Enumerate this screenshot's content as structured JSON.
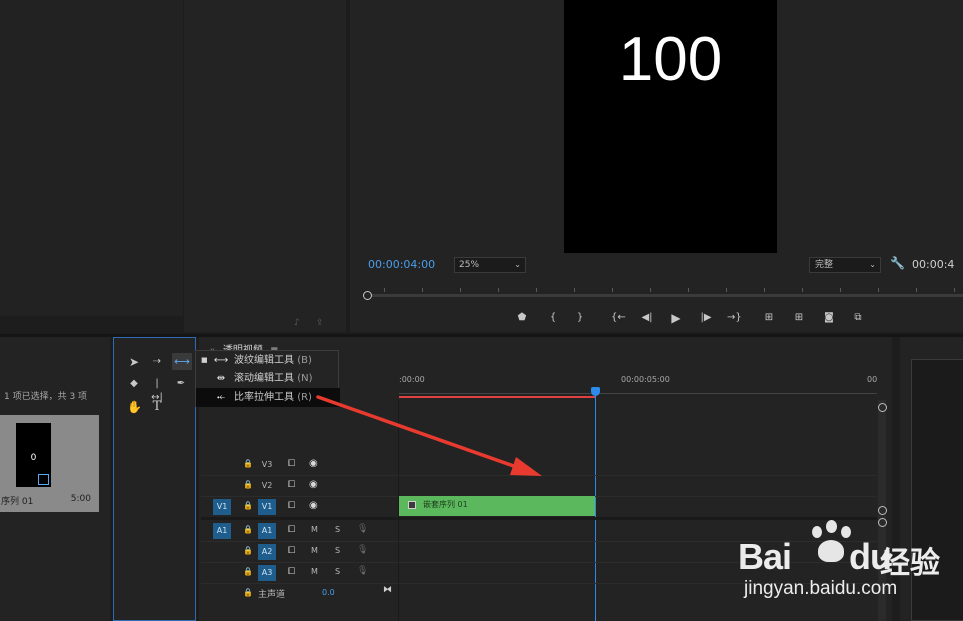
{
  "project_panel": {
    "selection_info": "1 项已选择，共 3 项",
    "clip_thumb_text": "0",
    "clip_name": "序列 01",
    "clip_duration": "5:00"
  },
  "program_monitor": {
    "frame_text": "100",
    "timecode": "00:00:04:00",
    "zoom": "25%",
    "quality": "完整",
    "duration_partial": "00:00:4",
    "playhead_fraction": 0.0
  },
  "timeline": {
    "sequence_name": "透明视频",
    "menu_icon": "≡",
    "ruler_start": ":00:00",
    "ruler_mid": "00:00:05:00",
    "ruler_end": "00",
    "clip_label": "嵌套序列 01",
    "master_label": "主声道",
    "master_value": "0.0",
    "tracks": {
      "v3": "V3",
      "v2": "V2",
      "v1": "V1",
      "v1_src": "V1",
      "a1": "A1",
      "a1_src": "A1",
      "a2": "A2",
      "a3": "A3",
      "mute": "M",
      "solo": "S"
    }
  },
  "tool_menu": {
    "items": [
      {
        "label": "波纹编辑工具",
        "key": "(B)",
        "selected": true
      },
      {
        "label": "滚动编辑工具",
        "key": "(N)",
        "selected": false
      },
      {
        "label": "比率拉伸工具",
        "key": "(R)",
        "selected": false
      }
    ]
  },
  "watermark": {
    "brand": "Bai",
    "brand2": "du",
    "brand_cn": "经验",
    "url": "jingyan.baidu.com"
  },
  "colors": {
    "accent": "#2d8ceb",
    "clip_green": "#5cb85c",
    "arrow_red": "#e83a2e",
    "source_toggle": "#1e5d8c"
  }
}
